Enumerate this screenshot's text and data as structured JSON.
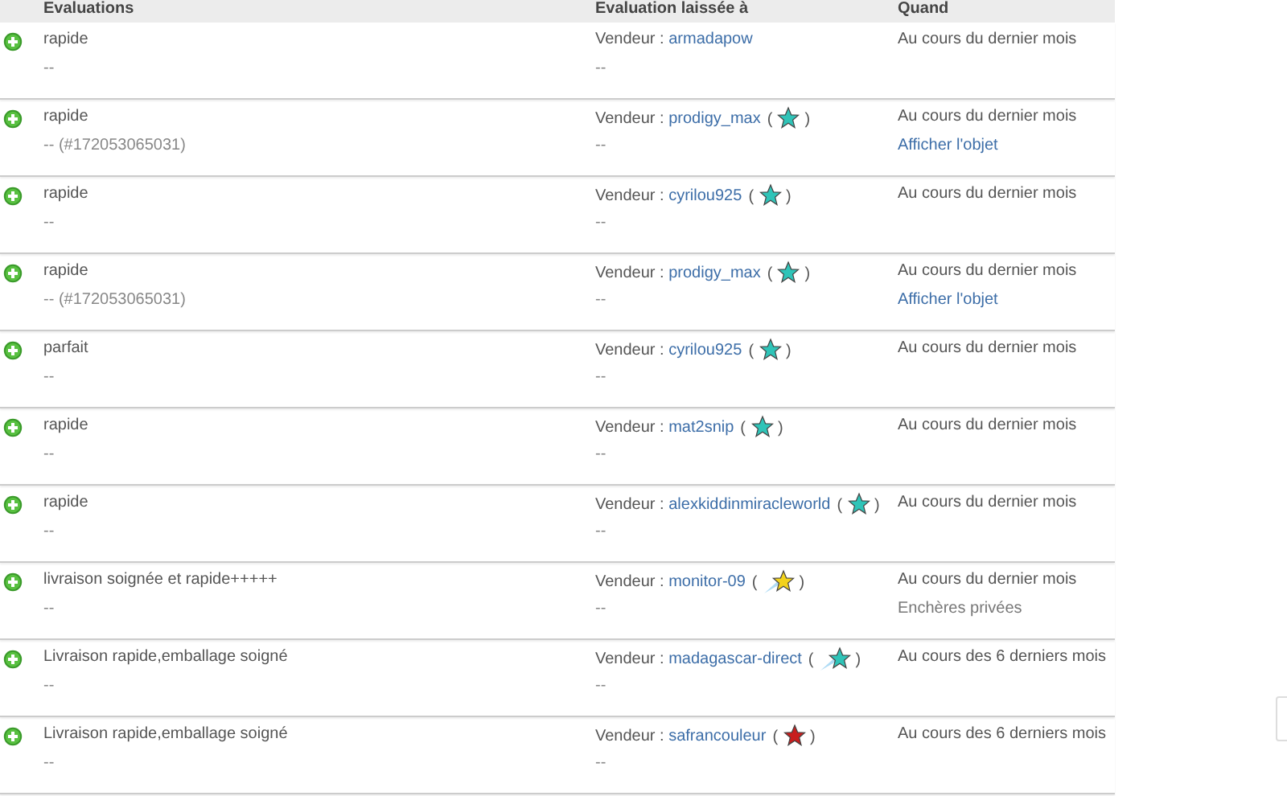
{
  "columns": [
    "Evaluations",
    "Evaluation laissée à",
    "Quand"
  ],
  "rows": [
    {
      "comment": "rapide",
      "detail": "--",
      "role": "Vendeur :",
      "user": "armadapow",
      "user_detail": "--",
      "when": "Au cours du dernier mois"
    },
    {
      "comment": "rapide",
      "detail": "-- (#172053065031)",
      "role": "Vendeur :",
      "user": "prodigy_max",
      "star": {
        "kind": "plain",
        "color": "#2fc4b8",
        "open": "(",
        "close": ")"
      },
      "user_detail": "--",
      "when": "Au cours du dernier mois",
      "extra": {
        "kind": "link",
        "text": "Afficher l'objet"
      }
    },
    {
      "comment": "rapide",
      "detail": "--",
      "role": "Vendeur :",
      "user": "cyrilou925",
      "star": {
        "kind": "plain",
        "color": "#2fc4b8",
        "open": "(",
        "close": ")"
      },
      "user_detail": "--",
      "when": "Au cours du dernier mois"
    },
    {
      "comment": "rapide",
      "detail": "-- (#172053065031)",
      "role": "Vendeur :",
      "user": "prodigy_max",
      "star": {
        "kind": "plain",
        "color": "#2fc4b8",
        "open": "(",
        "close": ")"
      },
      "user_detail": "--",
      "when": "Au cours du dernier mois",
      "extra": {
        "kind": "link",
        "text": "Afficher l'objet"
      }
    },
    {
      "comment": "parfait",
      "detail": "--",
      "role": "Vendeur :",
      "user": "cyrilou925",
      "star": {
        "kind": "plain",
        "color": "#2fc4b8",
        "open": "(",
        "close": ")"
      },
      "user_detail": "--",
      "when": "Au cours du dernier mois"
    },
    {
      "comment": "rapide",
      "detail": "--",
      "role": "Vendeur :",
      "user": "mat2snip",
      "star": {
        "kind": "plain",
        "color": "#2fc4b8",
        "open": "(",
        "close": ")"
      },
      "user_detail": "--",
      "when": "Au cours du dernier mois"
    },
    {
      "comment": "rapide",
      "detail": "--",
      "role": "Vendeur :",
      "user": "alexkiddinmiracleworld",
      "star": {
        "kind": "plain",
        "color": "#2fc4b8",
        "open": "(",
        "close": ")"
      },
      "user_detail": "--",
      "when": "Au cours du dernier mois"
    },
    {
      "comment": "livraison soignée et rapide+++++",
      "detail": "--",
      "role": "Vendeur :",
      "user": "monitor-09",
      "star": {
        "kind": "shooting",
        "color": "#f2d21c",
        "open": "(",
        "close": ")"
      },
      "user_detail": "--",
      "when": "Au cours du dernier mois",
      "extra": {
        "kind": "note",
        "text": "Enchères privées"
      }
    },
    {
      "comment": "Livraison rapide,emballage soigné",
      "detail": "--",
      "role": "Vendeur :",
      "user": "madagascar-direct",
      "star": {
        "kind": "shooting",
        "color": "#2fc4b8",
        "open": "(",
        "close": ")"
      },
      "user_detail": "--",
      "when": "Au cours des 6 derniers mois"
    },
    {
      "comment": "Livraison rapide,emballage soigné",
      "detail": "--",
      "role": "Vendeur :",
      "user": "safrancouleur",
      "star": {
        "kind": "plain",
        "color": "#c81e1e",
        "open": "(",
        "close": ")"
      },
      "user_detail": "--",
      "when": "Au cours des 6 derniers mois"
    }
  ]
}
